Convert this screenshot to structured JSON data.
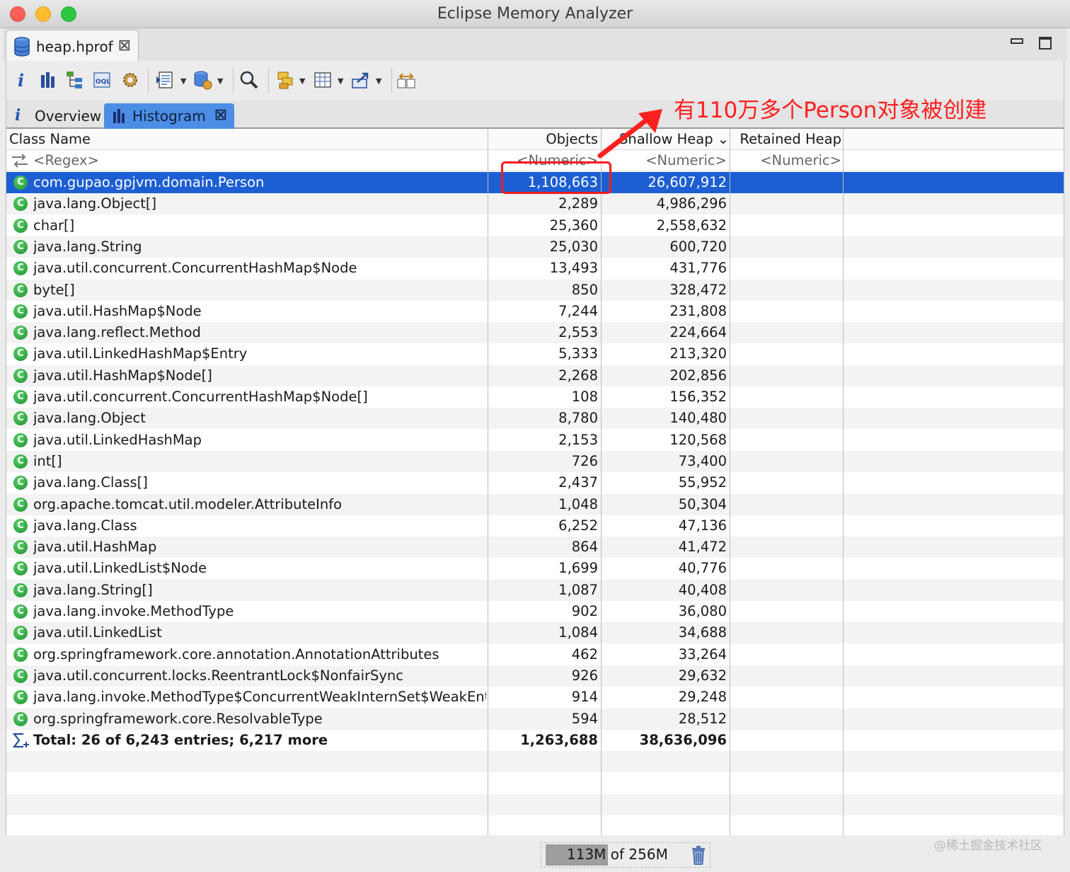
{
  "window": {
    "title": "Eclipse Memory Analyzer"
  },
  "editor_tab": {
    "label": "heap.hprof"
  },
  "toolbar": {
    "items": [
      "info-icon",
      "histogram-icon",
      "dominator-tree-icon",
      "oql-icon",
      "thread-overview-icon",
      "open-query-browser-icon",
      "group-result-icon",
      "search-icon",
      "calculate-retained-icon",
      "copy-icon",
      "export-icon",
      "compare-icon"
    ]
  },
  "inner_tabs": [
    {
      "label": "Overview",
      "icon": "info-icon"
    },
    {
      "label": "Histogram",
      "icon": "histogram-icon",
      "active": true
    }
  ],
  "table": {
    "columns": [
      "Class Name",
      "Objects",
      "Shallow Heap",
      "Retained Heap"
    ],
    "sort_column": "Shallow Heap",
    "filters": [
      "<Regex>",
      "<Numeric>",
      "<Numeric>",
      "<Numeric>"
    ],
    "rows": [
      {
        "name": "com.gupao.gpjvm.domain.Person",
        "objects": "1,108,663",
        "shallow": "26,607,912",
        "retained": ""
      },
      {
        "name": "java.lang.Object[]",
        "objects": "2,289",
        "shallow": "4,986,296",
        "retained": ""
      },
      {
        "name": "char[]",
        "objects": "25,360",
        "shallow": "2,558,632",
        "retained": ""
      },
      {
        "name": "java.lang.String",
        "objects": "25,030",
        "shallow": "600,720",
        "retained": ""
      },
      {
        "name": "java.util.concurrent.ConcurrentHashMap$Node",
        "objects": "13,493",
        "shallow": "431,776",
        "retained": ""
      },
      {
        "name": "byte[]",
        "objects": "850",
        "shallow": "328,472",
        "retained": ""
      },
      {
        "name": "java.util.HashMap$Node",
        "objects": "7,244",
        "shallow": "231,808",
        "retained": ""
      },
      {
        "name": "java.lang.reflect.Method",
        "objects": "2,553",
        "shallow": "224,664",
        "retained": ""
      },
      {
        "name": "java.util.LinkedHashMap$Entry",
        "objects": "5,333",
        "shallow": "213,320",
        "retained": ""
      },
      {
        "name": "java.util.HashMap$Node[]",
        "objects": "2,268",
        "shallow": "202,856",
        "retained": ""
      },
      {
        "name": "java.util.concurrent.ConcurrentHashMap$Node[]",
        "objects": "108",
        "shallow": "156,352",
        "retained": ""
      },
      {
        "name": "java.lang.Object",
        "objects": "8,780",
        "shallow": "140,480",
        "retained": ""
      },
      {
        "name": "java.util.LinkedHashMap",
        "objects": "2,153",
        "shallow": "120,568",
        "retained": ""
      },
      {
        "name": "int[]",
        "objects": "726",
        "shallow": "73,400",
        "retained": ""
      },
      {
        "name": "java.lang.Class[]",
        "objects": "2,437",
        "shallow": "55,952",
        "retained": ""
      },
      {
        "name": "org.apache.tomcat.util.modeler.AttributeInfo",
        "objects": "1,048",
        "shallow": "50,304",
        "retained": ""
      },
      {
        "name": "java.lang.Class",
        "objects": "6,252",
        "shallow": "47,136",
        "retained": ""
      },
      {
        "name": "java.util.HashMap",
        "objects": "864",
        "shallow": "41,472",
        "retained": ""
      },
      {
        "name": "java.util.LinkedList$Node",
        "objects": "1,699",
        "shallow": "40,776",
        "retained": ""
      },
      {
        "name": "java.lang.String[]",
        "objects": "1,087",
        "shallow": "40,408",
        "retained": ""
      },
      {
        "name": "java.lang.invoke.MethodType",
        "objects": "902",
        "shallow": "36,080",
        "retained": ""
      },
      {
        "name": "java.util.LinkedList",
        "objects": "1,084",
        "shallow": "34,688",
        "retained": ""
      },
      {
        "name": "org.springframework.core.annotation.AnnotationAttributes",
        "objects": "462",
        "shallow": "33,264",
        "retained": ""
      },
      {
        "name": "java.util.concurrent.locks.ReentrantLock$NonfairSync",
        "objects": "926",
        "shallow": "29,632",
        "retained": ""
      },
      {
        "name": "java.lang.invoke.MethodType$ConcurrentWeakInternSet$WeakEntry",
        "objects": "914",
        "shallow": "29,248",
        "retained": ""
      },
      {
        "name": "org.springframework.core.ResolvableType",
        "objects": "594",
        "shallow": "28,512",
        "retained": ""
      }
    ],
    "total": {
      "label": "Total: 26 of 6,243 entries; 6,217 more",
      "objects": "1,263,688",
      "shallow": "38,636,096"
    },
    "selected_row": 0
  },
  "annotation": {
    "text": "有110万多个Person对象被创建",
    "color": "#ff2020"
  },
  "status": {
    "heap_text": "113M of 256M",
    "heap_used_fraction": 0.44
  },
  "watermark": "@稀土掘金技术社区"
}
